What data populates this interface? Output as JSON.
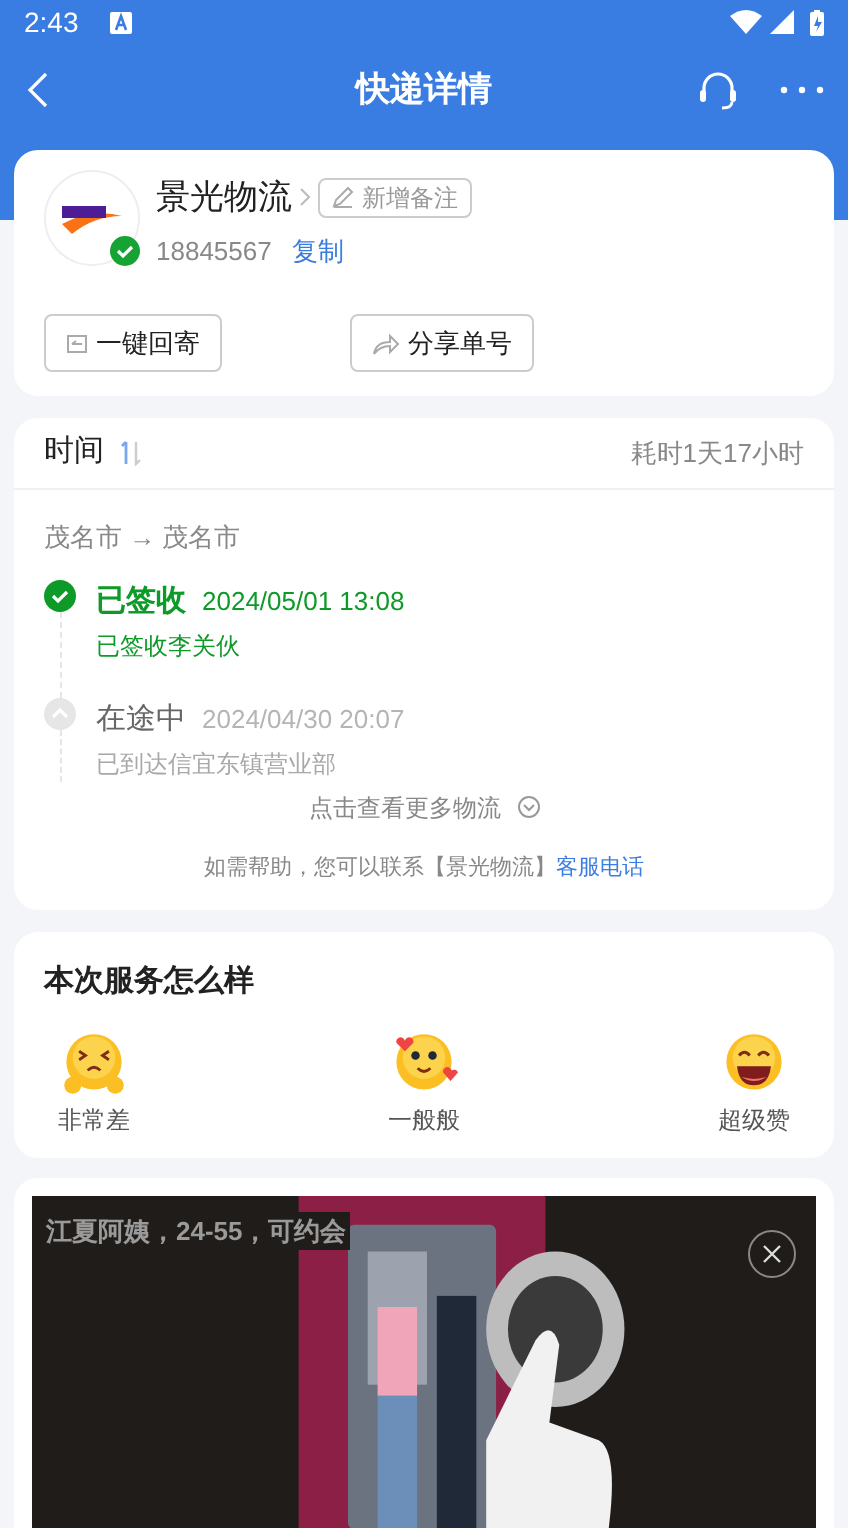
{
  "status_bar": {
    "time": "2:43"
  },
  "header": {
    "title": "快递详情"
  },
  "courier": {
    "name": "景光物流",
    "verified": true,
    "note_button": "新增备注",
    "tracking_number": "18845567",
    "copy_link": "复制",
    "actions": [
      "一键回寄",
      "分享单号"
    ]
  },
  "tracking": {
    "heading": "时间",
    "duration": "耗时1天17小时",
    "route": "茂名市 → 茂名市",
    "events": [
      {
        "status": "已签收",
        "time": "2024/05/01 13:08",
        "detail": "已签收李关伙",
        "kind": "done"
      },
      {
        "status": "在途中",
        "time": "2024/04/30 20:07",
        "detail": "已到达信宜东镇营业部",
        "kind": "transit"
      }
    ],
    "more_link": "点击查看更多物流",
    "help_text": "如需帮助，您可以联系【景光物流】",
    "help_link": "客服电话"
  },
  "rating": {
    "title": "本次服务怎么样",
    "options": [
      {
        "label": "非常差",
        "kind": "bad"
      },
      {
        "label": "一般般",
        "kind": "ok"
      },
      {
        "label": "超级赞",
        "kind": "great"
      }
    ]
  },
  "ad": {
    "caption": "江夏阿姨，24-55，可约会"
  }
}
